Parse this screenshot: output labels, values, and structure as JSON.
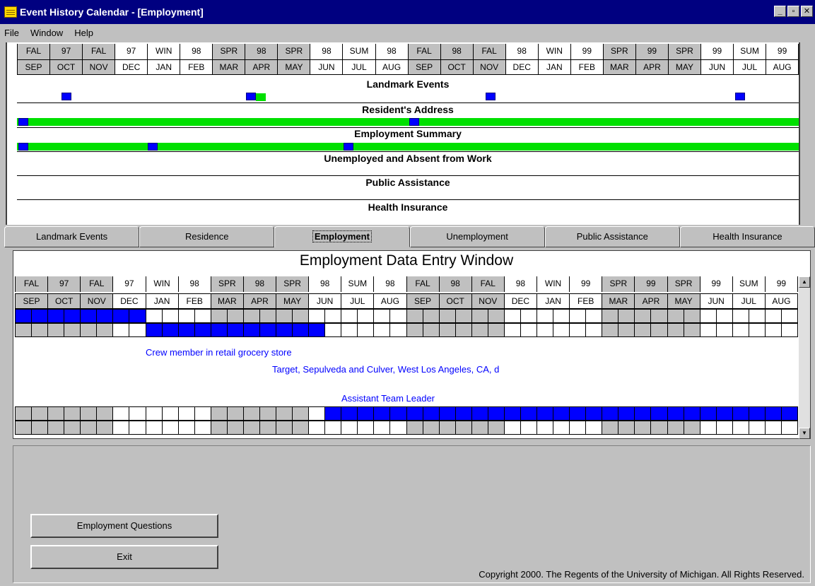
{
  "window": {
    "title": "Event History Calendar - [Employment]",
    "btn_min": "_",
    "btn_max": "▫",
    "btn_close": "✕"
  },
  "menu": [
    "File",
    "Window",
    "Help"
  ],
  "overview": {
    "seasons": [
      "FAL",
      "97",
      "FAL",
      "97",
      "WIN",
      "98",
      "SPR",
      "98",
      "SPR",
      "98",
      "SUM",
      "98",
      "FAL",
      "98",
      "FAL",
      "98",
      "WIN",
      "99",
      "SPR",
      "99",
      "SPR",
      "99",
      "SUM",
      "99"
    ],
    "months": [
      "SEP",
      "OCT",
      "NOV",
      "DEC",
      "JAN",
      "FEB",
      "MAR",
      "APR",
      "MAY",
      "JUN",
      "JUL",
      "AUG",
      "SEP",
      "OCT",
      "NOV",
      "DEC",
      "JAN",
      "FEB",
      "MAR",
      "APR",
      "MAY",
      "JUN",
      "JUL",
      "AUG"
    ],
    "sections": [
      "Landmark Events",
      "Resident's Address",
      "Employment Summary",
      "Unemployed and Absent from Work",
      "Public Assistance",
      "Health Insurance"
    ]
  },
  "tabs": [
    "Landmark Events",
    "Residence",
    "Employment",
    "Unemployment",
    "Public Assistance",
    "Health Insurance"
  ],
  "entry": {
    "title": "Employment Data Entry Window",
    "job_title": "Crew member in retail grocery store",
    "employer": "Target, Sepulveda and Culver, West Los Angeles, CA, d",
    "position2": "Assistant Team Leader"
  },
  "buttons": {
    "questions": "Employment Questions",
    "exit": "Exit"
  },
  "copyright": "Copyright 2000.  The Regents of the University of Michigan.  All Rights Reserved.",
  "colors": {
    "title_bg": "#000080",
    "bar_green": "#00e000",
    "mark_blue": "#0000ff",
    "text_blue": "#0000ff"
  }
}
